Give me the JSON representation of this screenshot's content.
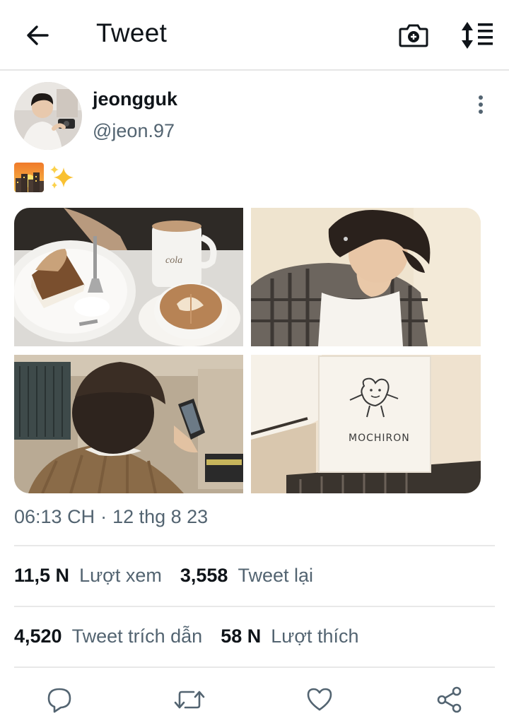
{
  "header": {
    "title": "Tweet",
    "back_icon": "arrow-left-icon",
    "camera_icon": "camera-plus-icon",
    "sort_icon": "sort-lines-icon"
  },
  "tweet": {
    "author": {
      "display_name": "jeongguk",
      "handle": "@jeon.97"
    },
    "text_emojis": [
      "sunset-city-emoji",
      "sparkles-emoji"
    ],
    "media": [
      {
        "subject": "cake and latte",
        "caption": "cola"
      },
      {
        "subject": "man in plaid shirt"
      },
      {
        "subject": "man in station with phone"
      },
      {
        "subject": "mochiron shop sign",
        "caption": "MOCHIRON"
      }
    ],
    "time": "06:13 CH",
    "separator": "·",
    "date": "12 thg 8 23"
  },
  "stats": {
    "views_num": "11,5 N",
    "views_label": "Lượt xem",
    "retweets_num": "3,558",
    "retweets_label": "Tweet lại",
    "quotes_num": "4,520",
    "quotes_label": "Tweet trích dẫn",
    "likes_num": "58 N",
    "likes_label": "Lượt thích"
  },
  "actions": [
    "reply-icon",
    "retweet-icon",
    "like-icon",
    "share-icon"
  ],
  "colors": {
    "text": "#0f1419",
    "secondary": "#536471",
    "divider": "#e8e8e8"
  }
}
